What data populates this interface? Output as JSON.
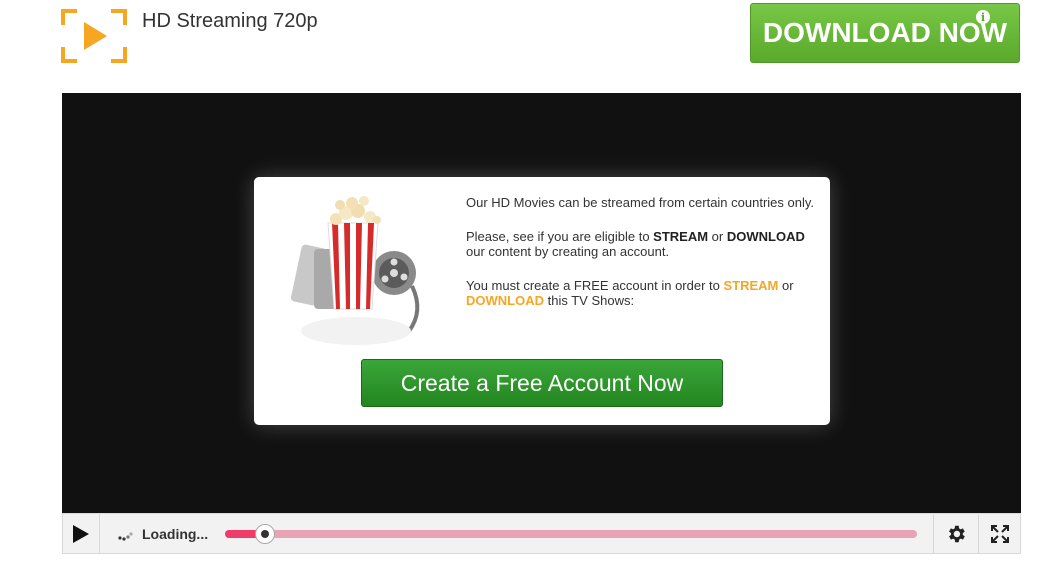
{
  "header": {
    "site_title": "HD Streaming 720p",
    "download_label": "DOWNLOAD NOW",
    "info_icon": "i"
  },
  "modal": {
    "para1": "Our HD Movies can be streamed from certain countries only.",
    "para2": {
      "pre": "Please, see if you are eligible to ",
      "stream": "STREAM",
      "mid": " or ",
      "download": "DOWNLOAD",
      "post": " our content by creating an account."
    },
    "para3": {
      "pre": "You must create a FREE account in order to ",
      "stream": "STREAM",
      "mid": " or ",
      "download": "DOWNLOAD",
      "post": " this TV Shows:"
    },
    "cta_label": "Create a Free Account Now"
  },
  "player": {
    "loading_text": "Loading...",
    "progress_percent": 5.8
  },
  "colors": {
    "accent_orange": "#f5a623",
    "download_green": "#5aa92c",
    "cta_green": "#2c962a",
    "progress_fill": "#ee3d6b",
    "progress_track": "#e6a4b4",
    "player_bg": "#111111"
  },
  "icons": {
    "logo": "play-logo-icon",
    "play": "play-icon",
    "spinner": "loading-spinner-icon",
    "settings": "gear-icon",
    "fullscreen": "fullscreen-icon"
  }
}
